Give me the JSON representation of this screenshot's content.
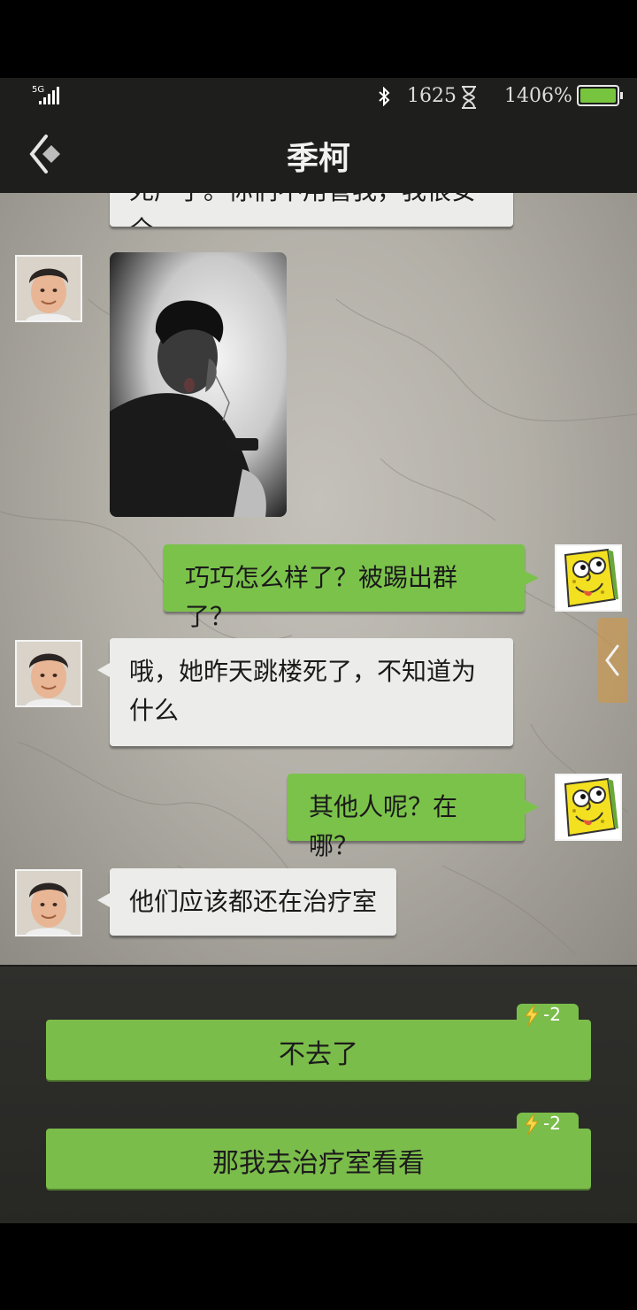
{
  "status_bar": {
    "network": "5G",
    "counter": "1625",
    "battery_percent": "1406%",
    "icons": [
      "signal-icon",
      "bluetooth-icon",
      "hourglass-icon",
      "battery-icon"
    ],
    "battery_color": "#77c43e"
  },
  "header": {
    "title": "季柯",
    "back_icon": "back-arrow-icon"
  },
  "chat": {
    "partial_message": "死产了。你们不用管我，我很安全",
    "messages": [
      {
        "side": "left",
        "type": "image",
        "sender": "季柯"
      },
      {
        "side": "right",
        "type": "text",
        "text": "巧巧怎么样了？被踢出群了？"
      },
      {
        "side": "left",
        "type": "text",
        "line1": "哦，她昨天跳楼死了，不知道为",
        "line2": "什么"
      },
      {
        "side": "right",
        "type": "text",
        "text": "其他人呢？在哪？"
      },
      {
        "side": "left",
        "type": "text",
        "text": "他们应该都还在治疗室"
      }
    ]
  },
  "choices": [
    {
      "label": "不去了",
      "cost": "-2",
      "cost_icon": "lightning-icon"
    },
    {
      "label": "那我去治疗室看看",
      "cost": "-2",
      "cost_icon": "lightning-icon"
    }
  ],
  "colors": {
    "bubble_right": "#7bc24b",
    "bubble_left": "#ececea",
    "choice_button": "#7bbd4a",
    "side_tab": "#d6963c"
  }
}
